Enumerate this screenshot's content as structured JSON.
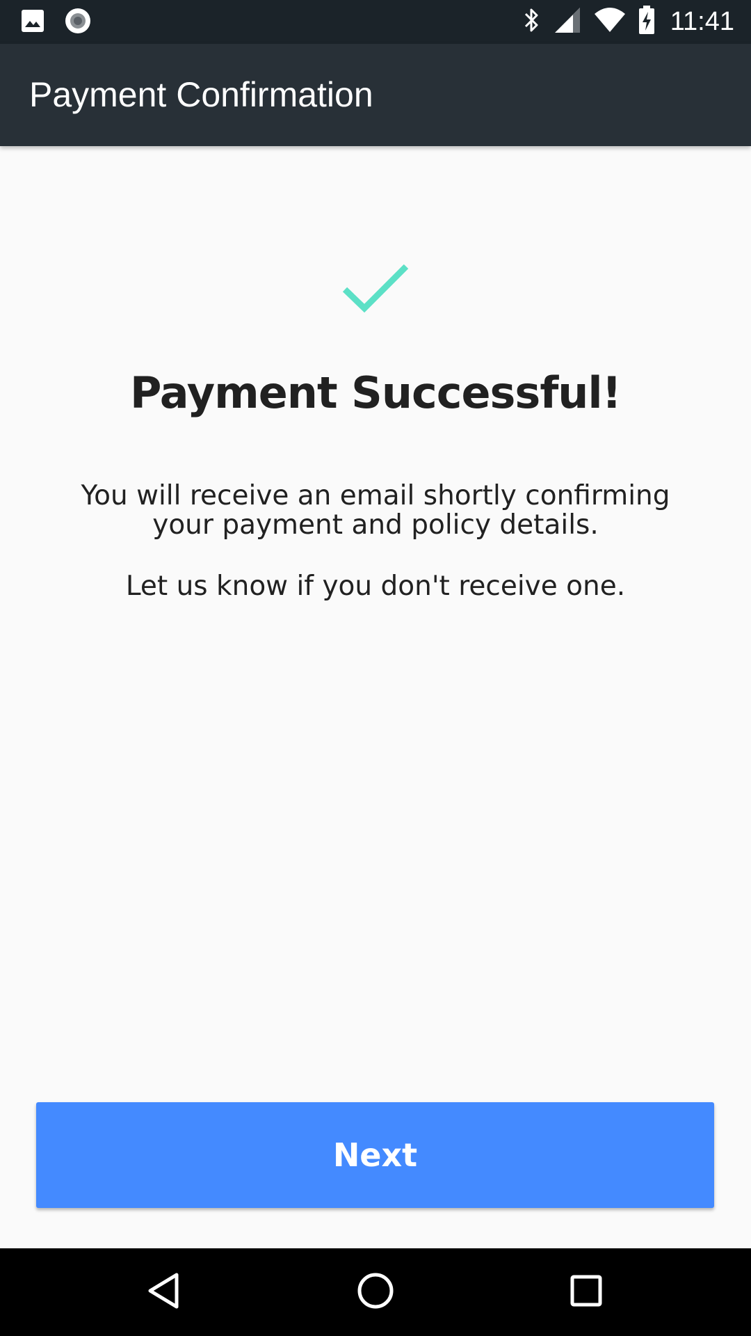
{
  "status_bar": {
    "time": "11:41",
    "left_icons": [
      "image-icon",
      "record-icon"
    ],
    "right_icons": [
      "bluetooth-icon",
      "cell-signal-icon",
      "wifi-icon",
      "battery-charging-icon"
    ]
  },
  "app_bar": {
    "title": "Payment Confirmation",
    "background": "#283037"
  },
  "confirmation": {
    "icon": "checkmark-icon",
    "icon_color": "#5ce0c6",
    "headline": "Payment Successful!",
    "message_1": "You will receive an email shortly confirming your payment and policy details.",
    "message_2": "Let us know if you don't receive one."
  },
  "actions": {
    "next_label": "Next",
    "next_color": "#448aff"
  },
  "nav_bar": {
    "buttons": [
      "back-icon",
      "home-icon",
      "recents-icon"
    ]
  }
}
